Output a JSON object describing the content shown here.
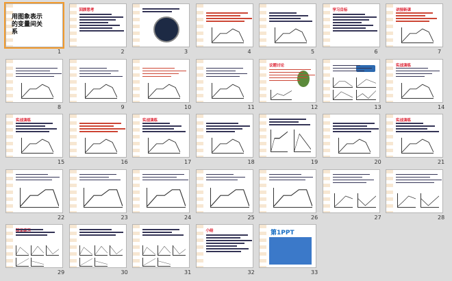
{
  "slides": [
    {
      "num": "1",
      "title": "用图象表示的变量间关系",
      "kind": "cover"
    },
    {
      "num": "2",
      "title": "回顾思考",
      "kind": "text"
    },
    {
      "num": "3",
      "title": "",
      "kind": "dial"
    },
    {
      "num": "4",
      "title": "",
      "kind": "text-chart"
    },
    {
      "num": "5",
      "title": "",
      "kind": "text-chart"
    },
    {
      "num": "6",
      "title": "学习目标",
      "kind": "text"
    },
    {
      "num": "7",
      "title": "讲授新课",
      "kind": "text-chart"
    },
    {
      "num": "8",
      "title": "",
      "kind": "text-chart"
    },
    {
      "num": "9",
      "title": "",
      "kind": "text-chart"
    },
    {
      "num": "10",
      "title": "",
      "kind": "text-chart"
    },
    {
      "num": "11",
      "title": "",
      "kind": "text-chart"
    },
    {
      "num": "12",
      "title": "议题讨论",
      "kind": "tree"
    },
    {
      "num": "13",
      "title": "",
      "kind": "bus"
    },
    {
      "num": "14",
      "title": "实战演练",
      "kind": "text-chart"
    },
    {
      "num": "15",
      "title": "实战演练",
      "kind": "text-chart"
    },
    {
      "num": "16",
      "title": "",
      "kind": "text-chart"
    },
    {
      "num": "17",
      "title": "实战演练",
      "kind": "text-chart"
    },
    {
      "num": "18",
      "title": "",
      "kind": "text-chart"
    },
    {
      "num": "19",
      "title": "",
      "kind": "boxes"
    },
    {
      "num": "20",
      "title": "",
      "kind": "text-chart"
    },
    {
      "num": "21",
      "title": "实战演练",
      "kind": "text-chart"
    },
    {
      "num": "22",
      "title": "",
      "kind": "step"
    },
    {
      "num": "23",
      "title": "",
      "kind": "step"
    },
    {
      "num": "24",
      "title": "",
      "kind": "step"
    },
    {
      "num": "25",
      "title": "",
      "kind": "step"
    },
    {
      "num": "26",
      "title": "",
      "kind": "step"
    },
    {
      "num": "27",
      "title": "",
      "kind": "sketch"
    },
    {
      "num": "28",
      "title": "",
      "kind": "sketch"
    },
    {
      "num": "29",
      "title": "随堂练习",
      "kind": "mini"
    },
    {
      "num": "30",
      "title": "",
      "kind": "mini"
    },
    {
      "num": "31",
      "title": "",
      "kind": "mini"
    },
    {
      "num": "32",
      "title": "小结",
      "kind": "text"
    },
    {
      "num": "33",
      "title": "第1PPT",
      "kind": "ad"
    }
  ],
  "colors": {
    "accent": "#f39a2b",
    "red": "#d22233"
  }
}
